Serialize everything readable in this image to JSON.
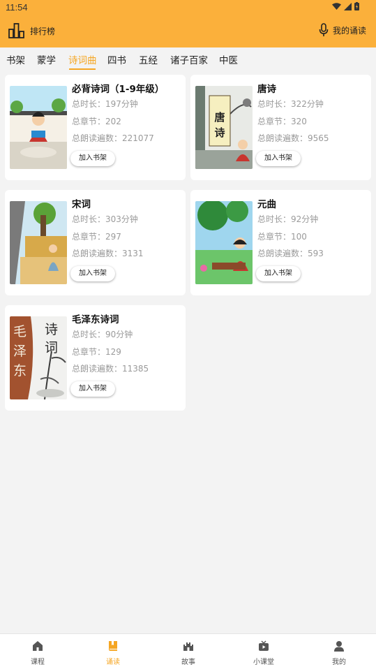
{
  "status_bar": {
    "time": "11:54"
  },
  "header": {
    "rank_label": "排行榜",
    "my_recitation_label": "我的诵读"
  },
  "tabs": [
    {
      "label": "书架",
      "active": false
    },
    {
      "label": "蒙学",
      "active": false
    },
    {
      "label": "诗词曲",
      "active": true
    },
    {
      "label": "四书",
      "active": false
    },
    {
      "label": "五经",
      "active": false
    },
    {
      "label": "诸子百家",
      "active": false
    },
    {
      "label": "中医",
      "active": false
    }
  ],
  "books": [
    {
      "title": "必背诗词（1-9年级）",
      "duration": "总时长：197分钟",
      "chapters": "总章节：202",
      "reads": "总朗读遍数：221077",
      "add_label": "加入书架",
      "cover_text": ""
    },
    {
      "title": "唐诗",
      "duration": "总时长：322分钟",
      "chapters": "总章节：320",
      "reads": "总朗读遍数：9565",
      "add_label": "加入书架",
      "cover_text": "唐诗"
    },
    {
      "title": "宋词",
      "duration": "总时长：303分钟",
      "chapters": "总章节：297",
      "reads": "总朗读遍数：3131",
      "add_label": "加入书架",
      "cover_text": ""
    },
    {
      "title": "元曲",
      "duration": "总时长：92分钟",
      "chapters": "总章节：100",
      "reads": "总朗读遍数：593",
      "add_label": "加入书架",
      "cover_text": ""
    },
    {
      "title": "毛泽东诗词",
      "duration": "总时长：90分钟",
      "chapters": "总章节：129",
      "reads": "总朗读遍数：11385",
      "add_label": "加入书架",
      "cover_text_left": "毛泽东",
      "cover_text_right": "诗词"
    }
  ],
  "bottom_nav": [
    {
      "label": "课程",
      "icon": "home-icon",
      "active": false
    },
    {
      "label": "诵读",
      "icon": "book-icon",
      "active": true
    },
    {
      "label": "故事",
      "icon": "castle-icon",
      "active": false
    },
    {
      "label": "小课堂",
      "icon": "tv-icon",
      "active": false
    },
    {
      "label": "我的",
      "icon": "person-icon",
      "active": false
    }
  ],
  "colors": {
    "accent": "#fbb03b",
    "active_text": "#f5a623",
    "meta_text": "#9a9a9a"
  }
}
